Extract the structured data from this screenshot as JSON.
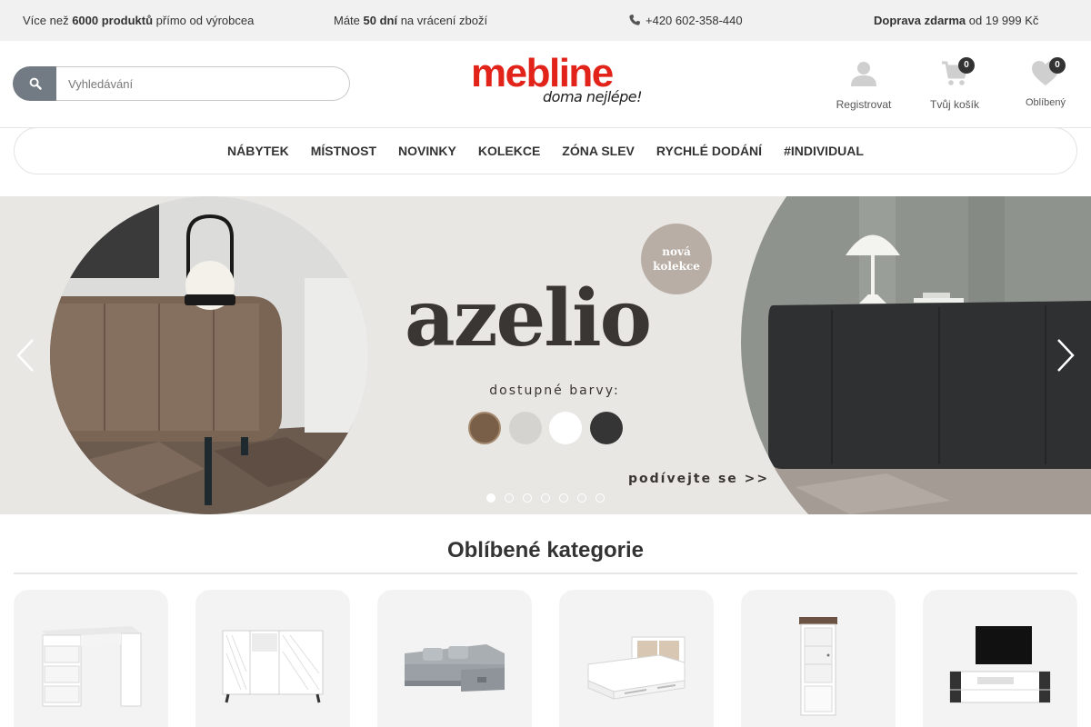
{
  "topbar": {
    "info1_pre": "Více než ",
    "info1_bold": "6000 produktů",
    "info1_post": " přímo od výrobcea",
    "info2_pre": "Máte ",
    "info2_bold": "50 dní",
    "info2_post": " na vrácení zboží",
    "phone": "+420 602-358-440",
    "info4_bold": "Doprava zdarma",
    "info4_post": " od 19 999 Kč"
  },
  "search": {
    "placeholder": "Vyhledávání"
  },
  "logo": {
    "main": "mebline",
    "tagline": "doma nejlépe!"
  },
  "actions": {
    "register": "Registrovat",
    "cart": "Tvůj košík",
    "cart_count": "0",
    "favorites": "Oblíbený",
    "favorites_count": "0"
  },
  "nav": [
    "NÁBYTEK",
    "MÍSTNOST",
    "NOVINKY",
    "KOLEKCE",
    "ZÓNA SLEV",
    "RYCHLÉ DODÁNÍ",
    "#INDIVIDUAL"
  ],
  "hero": {
    "title": "azelio",
    "badge_line1": "nová",
    "badge_line2": "kolekce",
    "subtitle": "dostupné barvy:",
    "cta": "podívejte se >>",
    "swatch_colors": [
      "#7a5f48",
      "#d4d3d0",
      "#ffffff",
      "#353535"
    ],
    "slide_count": 7,
    "active_slide": 1
  },
  "categories": {
    "title": "Oblíbené kategorie",
    "items": [
      "desk",
      "sideboard",
      "corner-sofa",
      "bed",
      "display-cabinet",
      "tv-stand"
    ]
  },
  "colors": {
    "brand": "#e2231a",
    "search_button": "#727a83",
    "badge": "#333333"
  }
}
